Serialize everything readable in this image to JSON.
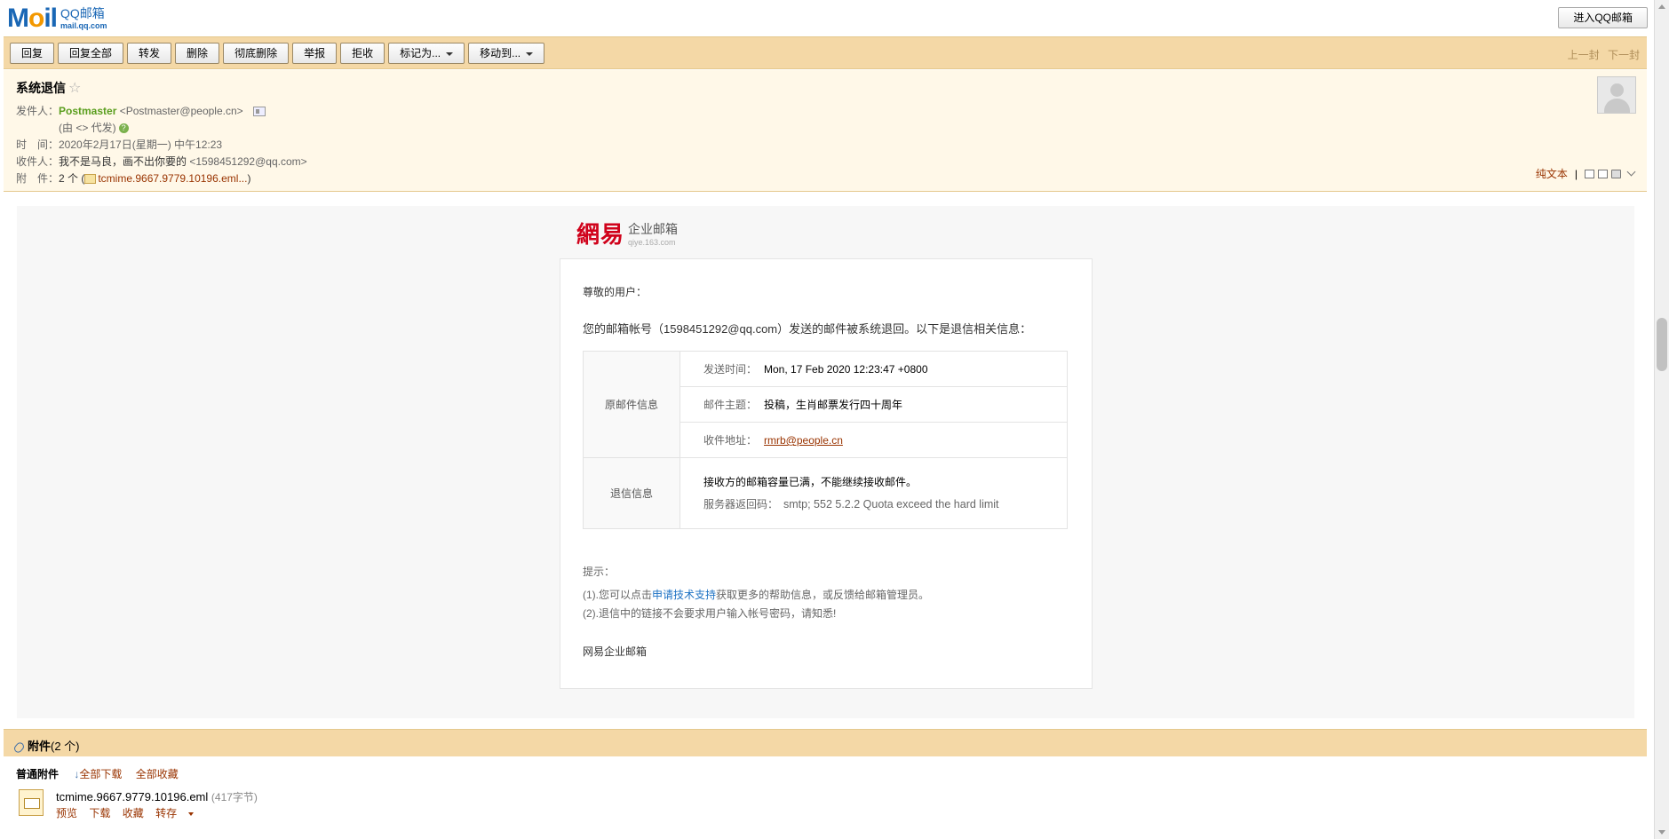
{
  "app": {
    "logo_mail": "M",
    "logo_o": "o",
    "logo_il": "il",
    "logo_qq": "QQ邮箱",
    "logo_domain": "mail.qq.com",
    "enter_qq_mail": "进入QQ邮箱"
  },
  "toolbar": {
    "reply": "回复",
    "reply_all": "回复全部",
    "forward": "转发",
    "delete": "删除",
    "delete_permanently": "彻底删除",
    "report": "举报",
    "reject": "拒收",
    "mark_as": "标记为...",
    "move_to": "移动到...",
    "prev": "上一封",
    "next": "下一封"
  },
  "header": {
    "subject": "系统退信",
    "star": "☆",
    "from_label": "发件人：",
    "from_name": "Postmaster",
    "from_addr": "<Postmaster@people.cn>",
    "via": "(由 <> 代发)",
    "time_label": "时　间：",
    "time": "2020年2月17日(星期一) 中午12:23",
    "to_label": "收件人：",
    "to_name": "我不是马良，画不出你要的",
    "to_addr": "<1598451292@qq.com>",
    "attach_label": "附　件：",
    "attach_count": "2 个 (",
    "attach_file": "tcmime.9667.9779.10196.eml...",
    "attach_close": ")",
    "plain_text": "纯文本",
    "sep": "|"
  },
  "body": {
    "brand_cn": "網易",
    "brand_name": "企业邮箱",
    "brand_domain": "qiye.163.com",
    "greeting": "尊敬的用户：",
    "intro": "您的邮箱帐号（1598451292@qq.com）发送的邮件被系统退回。以下是退信相关信息：",
    "original_label": "原邮件信息",
    "sent_time_label": "发送时间：",
    "sent_time": "Mon, 17 Feb 2020 12:23:47 +0800",
    "mail_subject_label": "邮件主题：",
    "mail_subject": "投稿，生肖邮票发行四十周年",
    "recipient_label": "收件地址：",
    "recipient": "rmrb@people.cn",
    "bounce_label": "退信信息",
    "bounce_reason": "接收方的邮箱容量已满，不能继续接收邮件。",
    "server_code_label": "服务器返回码：",
    "server_code": "smtp; 552 5.2.2 Quota exceed the hard limit",
    "hint_title": "提示：",
    "hint1_a": "(1).您可以点击",
    "hint1_link": "申请技术支持",
    "hint1_b": "获取更多的帮助信息，或反馈给邮箱管理员。",
    "hint2": "(2).退信中的链接不会要求用户输入帐号密码，请知悉!",
    "signature": "网易企业邮箱"
  },
  "attachments": {
    "title": "附件",
    "count": "(2 个)",
    "category": "普通附件",
    "download_all": "全部下载",
    "collect_all": "全部收藏",
    "items": [
      {
        "name": "tcmime.9667.9779.10196.eml",
        "size": "(417字节)",
        "preview": "预览",
        "download": "下载",
        "collect": "收藏",
        "save_to": "转存"
      }
    ]
  },
  "colors": {
    "toolbar_bg": "#f4d8a6",
    "header_bg": "#fff8e8",
    "link": "#993300",
    "sender": "#5a9e1e",
    "brand_red": "#d0021b"
  }
}
